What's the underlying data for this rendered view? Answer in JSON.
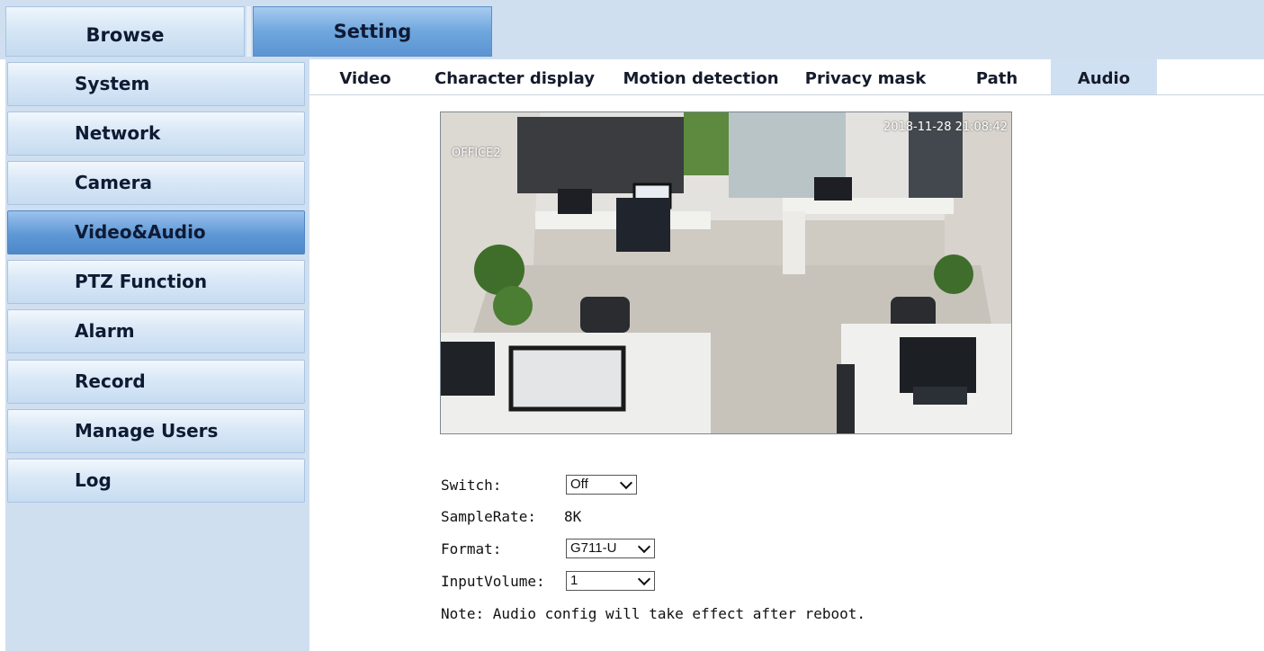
{
  "top_tabs": {
    "browse": "Browse",
    "setting": "Setting"
  },
  "sidebar": {
    "items": [
      {
        "label": "System"
      },
      {
        "label": "Network"
      },
      {
        "label": "Camera"
      },
      {
        "label": "Video&Audio"
      },
      {
        "label": "PTZ Function"
      },
      {
        "label": "Alarm"
      },
      {
        "label": "Record"
      },
      {
        "label": "Manage Users"
      },
      {
        "label": "Log"
      }
    ],
    "active": "Video&Audio"
  },
  "subtabs": {
    "items": [
      {
        "label": "Video"
      },
      {
        "label": "Character display"
      },
      {
        "label": "Motion detection"
      },
      {
        "label": "Privacy mask"
      },
      {
        "label": "Path"
      },
      {
        "label": "Audio"
      }
    ],
    "active": "Audio"
  },
  "preview": {
    "camera_name": "OFFICE2",
    "timestamp": "2018-11-28  21:08:42"
  },
  "audio_form": {
    "switch_label": "Switch:",
    "switch_value": "Off",
    "samplerate_label": "SampleRate:",
    "samplerate_value": "8K",
    "format_label": "Format:",
    "format_value": "G711-U",
    "inputvolume_label": "InputVolume:",
    "inputvolume_value": "1",
    "note": "Note: Audio config will take effect after reboot."
  },
  "colors": {
    "panel_bg": "#cfdff0",
    "active_tab": "#5e98d6",
    "subtab_active": "#cfe0f3"
  }
}
